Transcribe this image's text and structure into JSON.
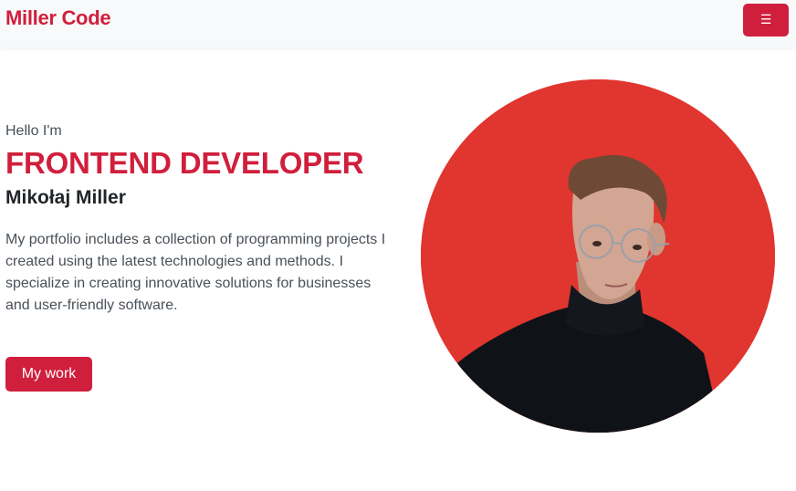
{
  "navbar": {
    "brand": "Miller Code",
    "menu_icon": "hamburger-icon",
    "menu_glyph": "☰"
  },
  "hero": {
    "greeting": "Hello I'm",
    "role": "FRONTEND DEVELOPER",
    "name": "Mikołaj Miller",
    "bio": "My portfolio includes a collection of programming projects I created using the latest technologies and methods. I specialize in creating innovative solutions for businesses and user-friendly software.",
    "cta_label": "My work"
  },
  "colors": {
    "accent": "#d01f3c",
    "navbar_bg": "#f8f9fa",
    "portrait_bg": "#e1352f"
  }
}
